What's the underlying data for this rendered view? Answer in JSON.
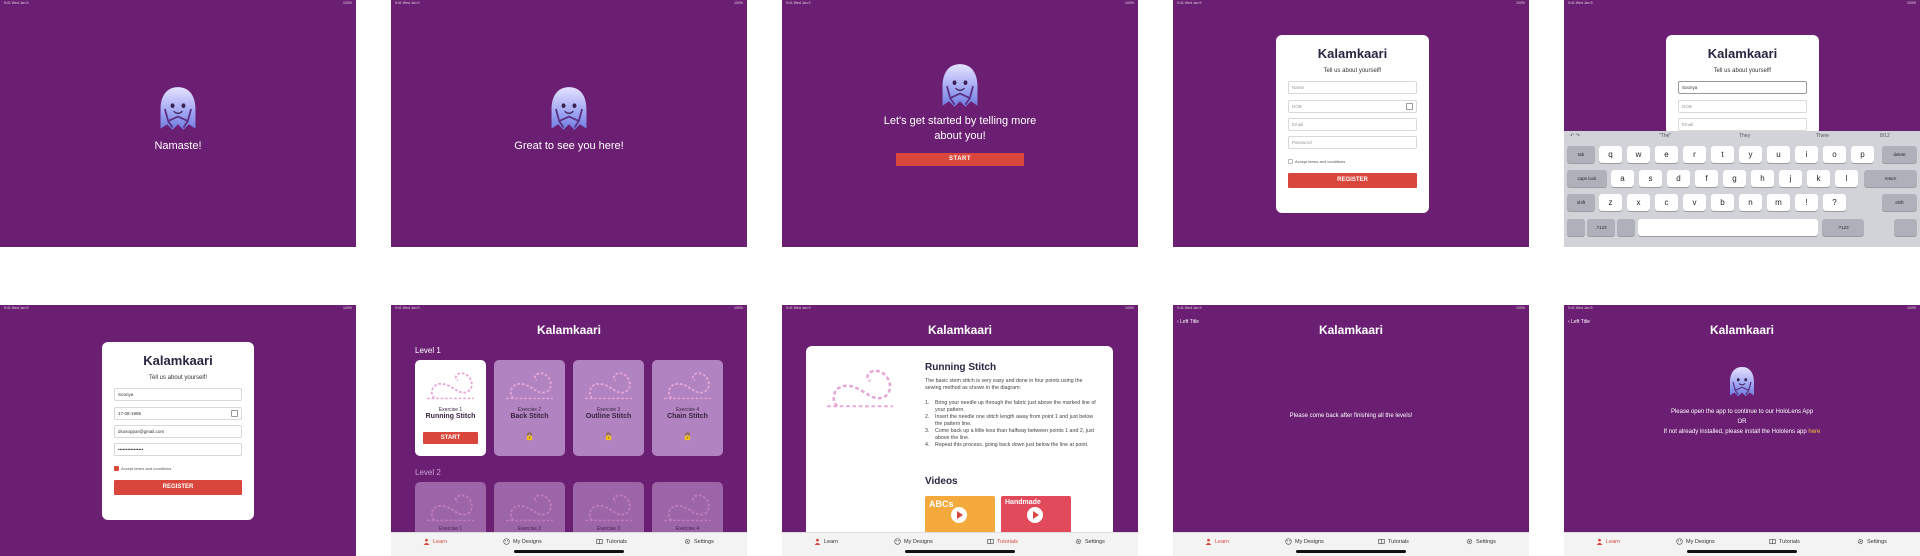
{
  "status": {
    "time": "9:41 Wed Jan 9",
    "battery": "100%"
  },
  "app_name": "Kalamkaari",
  "splash": {
    "namaste": "Namaste!",
    "great": "Great to see you here!",
    "started": "Let's get started by telling more about you!",
    "start_label": "START"
  },
  "form": {
    "subtitle": "Tell us about yourself!",
    "name_placeholder": "Name",
    "dob_placeholder": "DOB",
    "email_placeholder": "Email",
    "password_placeholder": "Password",
    "terms_label": "Accept terms and conditions",
    "register_label": "REGISTER",
    "typed_name": "Soonya",
    "filled_name": "Soonya",
    "filled_dob": "17-08-1995",
    "filled_email": "dsosoppar@gmail.com",
    "filled_password": "••••••••••••••••"
  },
  "keyboard": {
    "suggestions": [
      "\"The\"",
      "They",
      "There"
    ],
    "row1": [
      "q",
      "w",
      "e",
      "r",
      "t",
      "y",
      "u",
      "i",
      "o",
      "p"
    ],
    "row2": [
      "a",
      "s",
      "d",
      "f",
      "g",
      "h",
      "j",
      "k",
      "l"
    ],
    "row3": [
      "z",
      "x",
      "c",
      "v",
      "b",
      "n",
      "m",
      "!",
      "?"
    ],
    "tab_key": "tab",
    "delete_key": "delete",
    "caps_key": "caps lock",
    "return_key": "return",
    "shift_key": "shift",
    "numbers_key": ".?123",
    "page_indicator": "8/12"
  },
  "learn": {
    "level1": "Level 1",
    "level2": "Level 2",
    "exercises": [
      {
        "ex": "Exercise 1",
        "name": "Running Stitch"
      },
      {
        "ex": "Exercise 2",
        "name": "Back Stitch"
      },
      {
        "ex": "Exercise 3",
        "name": "Outline Stitch"
      },
      {
        "ex": "Exercise 4",
        "name": "Chain Stitch"
      }
    ],
    "level2_partial": [
      "Exercise 1",
      "Exercise 2",
      "Exercise 3",
      "Exercise 4"
    ],
    "start_label": "START"
  },
  "tutorial": {
    "title": "Running Stitch",
    "intro": "The basic stem stitch is very easy and done in four points using the sewing method as shown in the diagram:",
    "steps": [
      "Bring your needle up through the fabric just above the marked line of your pattern.",
      "Insert the needle one stitch length away from point 1 and just below the pattern line.",
      "Come back up a little less than halfway between points 1 and 2, just above the line.",
      "Repeat this process, going back down just below the line at point."
    ],
    "videos_heading": "Videos",
    "video1_text": "ABCs",
    "video2_text": "Handmade"
  },
  "designs": {
    "back_label": "Left Title",
    "message": "Please come back after finishing all the levels!"
  },
  "settings": {
    "back_label": "Left Title",
    "line1": "Please open the app to continue to our HoloLens App",
    "or": "OR",
    "line2": "If not already installed, please install the Hololens app",
    "here": "here"
  },
  "tabs": {
    "learn": "Learn",
    "designs": "My Designs",
    "tutorials": "Tutorials",
    "settings": "Settings"
  },
  "colors": {
    "purple": "#6b1f72",
    "accent": "#d9473c",
    "tile_locked": "#b183c0"
  }
}
